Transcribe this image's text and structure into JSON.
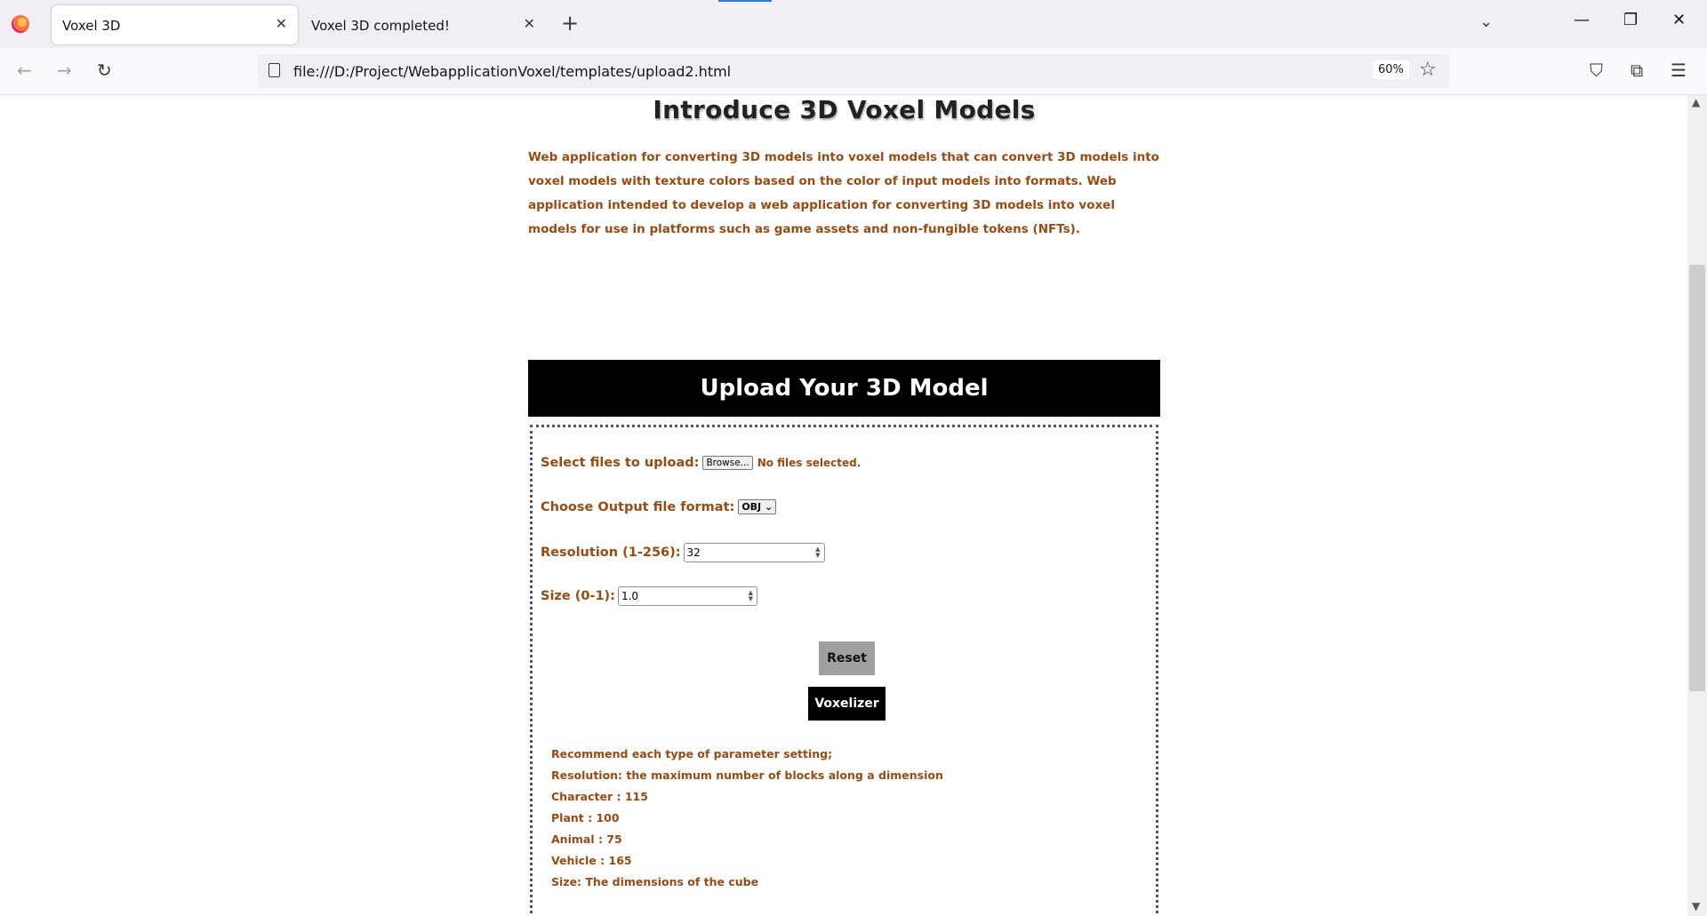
{
  "browser": {
    "tabs": [
      {
        "title": "Voxel 3D",
        "active": true
      },
      {
        "title": "Voxel 3D completed!",
        "active": false
      }
    ],
    "url": "file:///D:/Project/WebapplicationVoxel/templates/upload2.html",
    "zoom": "60%"
  },
  "page": {
    "title": "Introduce 3D Voxel Models",
    "intro": "Web application for converting 3D models into voxel models that can convert 3D models into voxel models with texture colors based on the color of input models into formats. Web application intended to develop a web application for converting 3D models into voxel models for use in platforms such as game assets and non-fungible tokens (NFTs).",
    "upload_header": "Upload Your 3D Model",
    "form": {
      "file_label": "Select files to upload:",
      "browse_label": "Browse...",
      "no_files": "No files selected.",
      "format_label": "Choose Output file format:",
      "format_value": "OBJ",
      "resolution_label": "Resolution (1-256):",
      "resolution_value": "32",
      "size_label": "Size (0-1):",
      "size_value": "1.0",
      "reset_label": "Reset",
      "voxelize_label": "Voxelizer"
    },
    "recommendations": [
      "Recommend each type of parameter setting;",
      "Resolution: the maximum number of blocks along a dimension",
      "Character : 115",
      "Plant : 100",
      "Animal : 75",
      "Vehicle : 165",
      "Size: The dimensions of the cube"
    ]
  },
  "icons": [
    "firefox-logo",
    "close-tab-icon",
    "new-tab-icon",
    "list-all-tabs-icon",
    "minimize-icon",
    "restore-icon",
    "close-window-icon",
    "back-icon",
    "forward-icon",
    "reload-icon",
    "page-icon",
    "bookmark-star-icon",
    "pocket-icon",
    "extensions-icon",
    "menu-icon"
  ],
  "colors": {
    "accent_text": "#9c4a10",
    "header_bg": "#000000"
  }
}
